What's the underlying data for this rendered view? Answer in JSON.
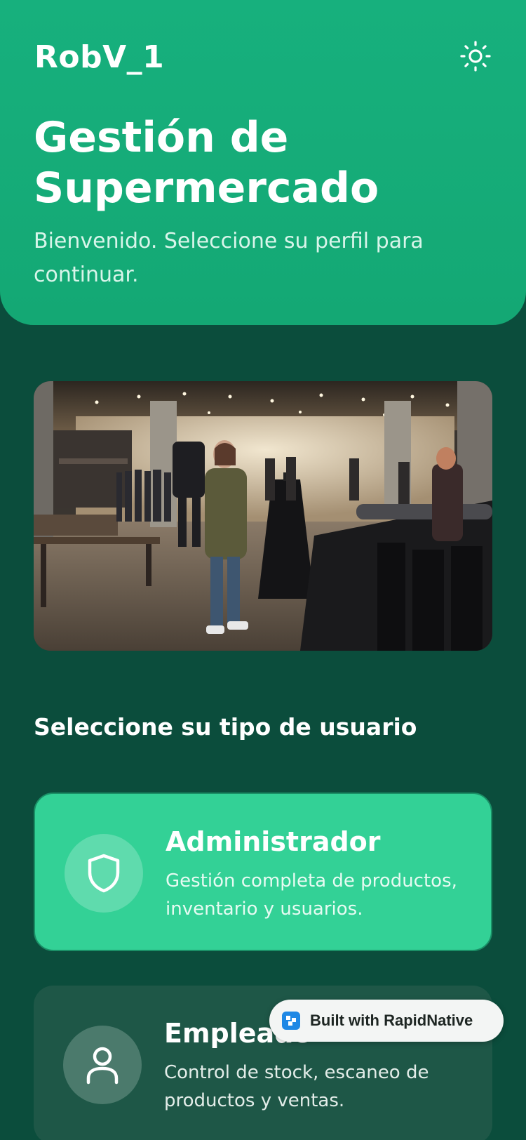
{
  "header": {
    "app_name": "RobV_1",
    "theme_icon": "sun-icon",
    "title": "Gestión de Supermercado",
    "subtitle": "Bienvenido. Seleccione su perfil para continuar."
  },
  "hero": {
    "image": "clothing-store-photo"
  },
  "section": {
    "title": "Seleccione su tipo de usuario"
  },
  "roles": [
    {
      "title": "Administrador",
      "description": "Gestión completa de productos, inventario y usuarios.",
      "icon": "shield-icon"
    },
    {
      "title": "Empleado",
      "description": "Control de stock, escaneo de productos y ventas.",
      "icon": "user-icon"
    }
  ],
  "badge": {
    "label": "Built with RapidNative",
    "icon": "rapidnative-logo-icon"
  },
  "colors": {
    "background": "#0b4d3c",
    "header": "#17b07d",
    "admin_card": "#33d196",
    "employee_card": "#1e5747"
  }
}
